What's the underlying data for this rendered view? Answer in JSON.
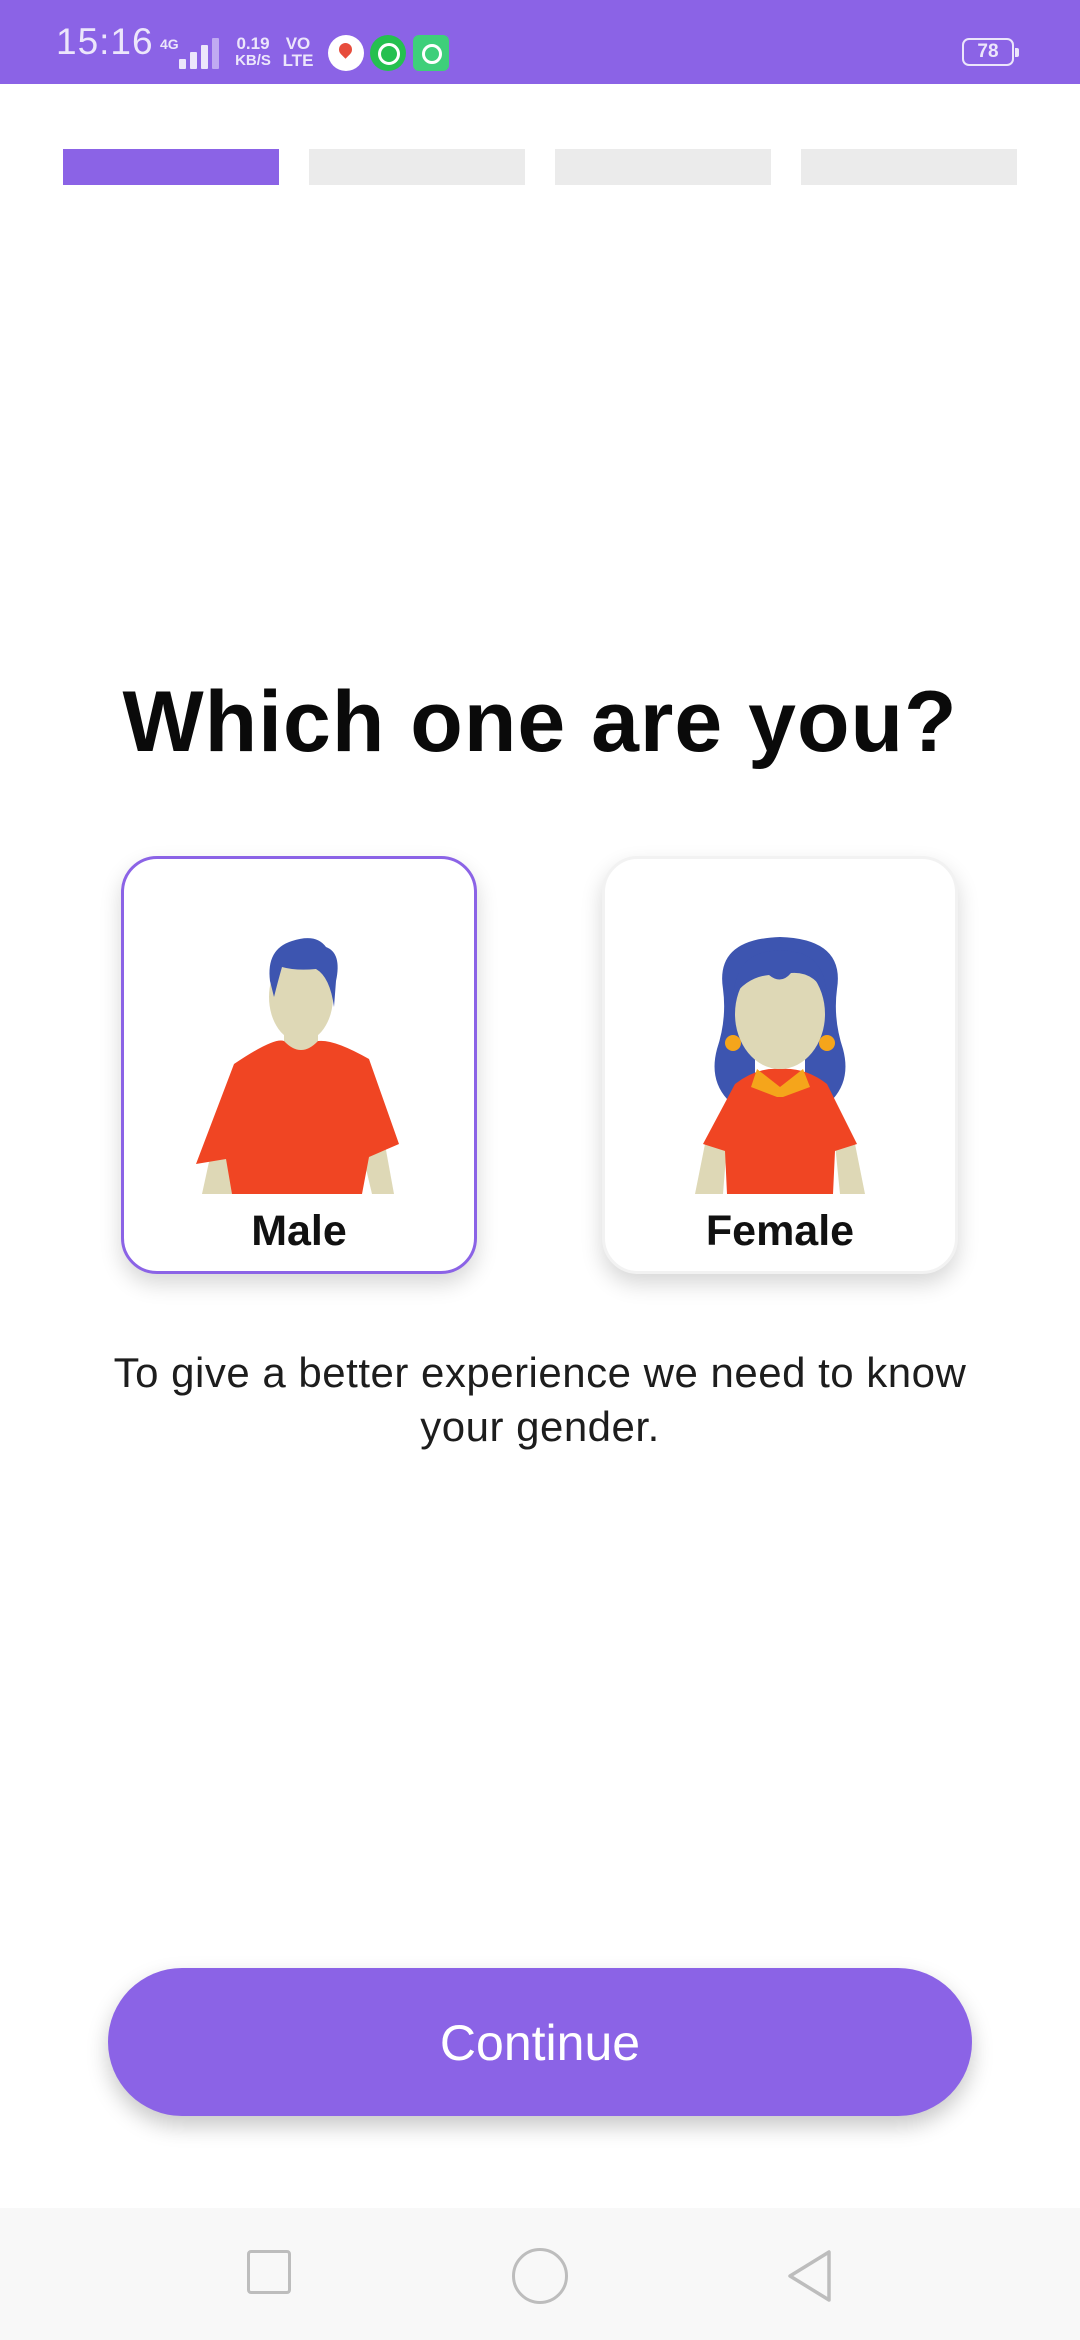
{
  "status_bar": {
    "time": "15:16",
    "network": "4G",
    "speed_value": "0.19",
    "speed_unit": "KB/S",
    "volte_top": "VO",
    "volte_bottom": "LTE",
    "battery": "78",
    "icons": [
      "maps-icon",
      "whatsapp-icon",
      "chat-icon"
    ]
  },
  "progress": {
    "total_steps": 4,
    "current_step": 1
  },
  "main": {
    "title": "Which one are you?",
    "options": [
      {
        "label": "Male",
        "selected": true
      },
      {
        "label": "Female",
        "selected": false
      }
    ],
    "subtitle": "To give a better experience we need to know your gender.",
    "continue_label": "Continue"
  },
  "nav_bar": {
    "icons": [
      "recents-icon",
      "home-icon",
      "back-icon"
    ]
  },
  "colors": {
    "accent": "#8b63e6",
    "inactive_step": "#ebebeb",
    "shirt": "#f04523",
    "hair": "#3d55b0",
    "skin": "#ded8b6",
    "earring": "#f5a51b"
  }
}
